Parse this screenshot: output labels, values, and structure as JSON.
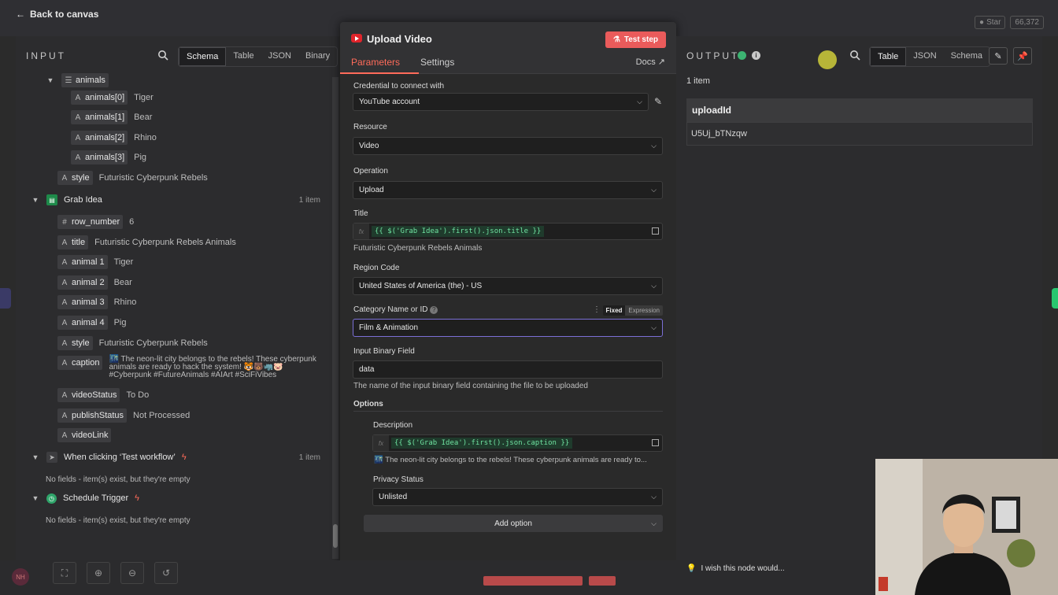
{
  "topbar": {
    "back_label": "Back to canvas",
    "github_star": "Star",
    "github_count": "66,372"
  },
  "input": {
    "title": "INPUT",
    "tabs": [
      "Schema",
      "Table",
      "JSON",
      "Binary"
    ],
    "active_tab": "Schema",
    "animals_group": "animals",
    "animals": [
      {
        "key": "animals[0]",
        "value": "Tiger"
      },
      {
        "key": "animals[1]",
        "value": "Bear"
      },
      {
        "key": "animals[2]",
        "value": "Rhino"
      },
      {
        "key": "animals[3]",
        "value": "Pig"
      }
    ],
    "style_top": {
      "key": "style",
      "value": "Futuristic Cyberpunk Rebels"
    },
    "grab_idea": {
      "name": "Grab Idea",
      "count": "1 item",
      "fields": [
        {
          "type": "#",
          "key": "row_number",
          "value": "6"
        },
        {
          "type": "A",
          "key": "title",
          "value": "Futuristic Cyberpunk Rebels Animals"
        },
        {
          "type": "A",
          "key": "animal 1",
          "value": "Tiger"
        },
        {
          "type": "A",
          "key": "animal 2",
          "value": "Bear"
        },
        {
          "type": "A",
          "key": "animal 3",
          "value": "Rhino"
        },
        {
          "type": "A",
          "key": "animal 4",
          "value": "Pig"
        },
        {
          "type": "A",
          "key": "style",
          "value": "Futuristic Cyberpunk Rebels"
        }
      ],
      "caption": {
        "type": "A",
        "key": "caption",
        "value": "🌃 The neon-lit city belongs to the rebels! These cyberpunk animals are ready to hack the system! 🐯🐻🦏🐷 #Cyberpunk #FutureAnimals #AIArt #SciFiVibes"
      },
      "more_fields": [
        {
          "type": "A",
          "key": "videoStatus",
          "value": "To Do"
        },
        {
          "type": "A",
          "key": "publishStatus",
          "value": "Not Processed"
        },
        {
          "type": "A",
          "key": "videoLink",
          "value": ""
        }
      ]
    },
    "test_workflow": {
      "name": "When clicking ‘Test workflow’",
      "count": "1 item",
      "empty": "No fields - item(s) exist, but they're empty"
    },
    "schedule": {
      "name": "Schedule Trigger",
      "empty": "No fields - item(s) exist, but they're empty"
    }
  },
  "modal": {
    "title": "Upload Video",
    "test_button": "Test step",
    "tabs": [
      "Parameters",
      "Settings"
    ],
    "docs": "Docs",
    "credential_label": "Credential to connect with",
    "credential_value": "YouTube account",
    "resource_label": "Resource",
    "resource_value": "Video",
    "operation_label": "Operation",
    "operation_value": "Upload",
    "title_label": "Title",
    "title_expr": "{{ $('Grab Idea').first().json.title }}",
    "title_preview": "Futuristic Cyberpunk Rebels Animals",
    "region_label": "Region Code",
    "region_value": "United States of America (the) - US",
    "category_label": "Category Name or ID",
    "category_toggle": [
      "Fixed",
      "Expression"
    ],
    "category_value": "Film & Animation",
    "binary_label": "Input Binary Field",
    "binary_value": "data",
    "binary_hint": "The name of the input binary field containing the file to be uploaded",
    "options_label": "Options",
    "description_label": "Description",
    "description_expr": "{{ $('Grab Idea').first().json.caption }}",
    "description_preview": "🌃 The neon-lit city belongs to the rebels! These cyberpunk animals are ready to...",
    "privacy_label": "Privacy Status",
    "privacy_value": "Unlisted",
    "add_option": "Add option"
  },
  "output": {
    "title": "OUTPUT",
    "tabs": [
      "Table",
      "JSON",
      "Schema"
    ],
    "active_tab": "Table",
    "items": "1 item",
    "column": "uploadId",
    "cell": "U5Uj_bTNzqw",
    "wish": "I wish this node would..."
  },
  "colors": {
    "accent": "#ff6b5a",
    "test_button": "#ea5b5b",
    "success": "#3cb371",
    "expression": "#6fe3a1"
  }
}
